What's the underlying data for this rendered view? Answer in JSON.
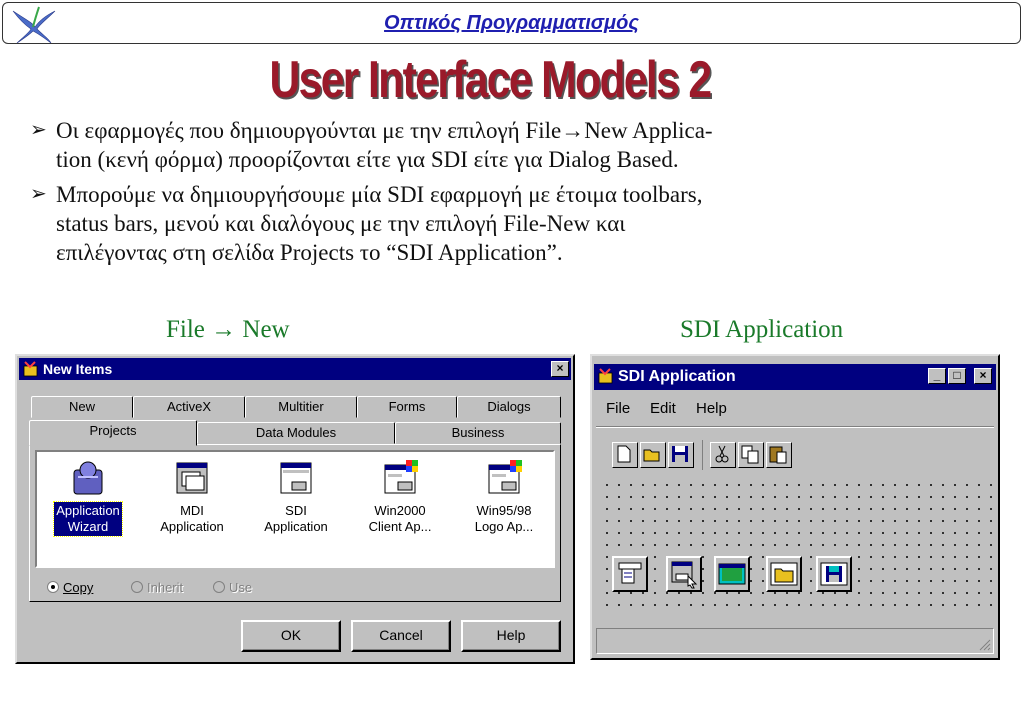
{
  "header": {
    "title": "Οπτικός Προγραμματισμός"
  },
  "slide": {
    "title": "User Interface Models 2",
    "bullets": [
      {
        "line1": "Οι εφαρμογές που δημιουργούνται με την επιλογή File→New Applica-",
        "line2": "tion (κενή φόρμα) προορίζονται είτε για SDI είτε για Dialog Based."
      },
      {
        "line1": "Μπορούμε να δημιουργήσουμε μία SDI εφαρμογή με έτοιμα toolbars,",
        "line2": "status bars, μενού και διαλόγους με την επιλογή File-New και",
        "line3": "επιλέγοντας στη σελίδα Projects το “SDI Application”."
      }
    ],
    "caption_left": "File → New",
    "caption_right": "SDI Application"
  },
  "new_items": {
    "title": "New Items",
    "tabs_back": [
      "New",
      "ActiveX",
      "Multitier",
      "Forms",
      "Dialogs"
    ],
    "tabs_front": [
      "Projects",
      "Data Modules",
      "Business"
    ],
    "items": [
      {
        "line1": "Application",
        "line2": "Wizard",
        "icon": "wizard-icon"
      },
      {
        "line1": "MDI",
        "line2": "Application",
        "icon": "mdi-app-icon"
      },
      {
        "line1": "SDI",
        "line2": "Application",
        "icon": "sdi-app-icon"
      },
      {
        "line1": "Win2000",
        "line2": "Client Ap...",
        "icon": "win2000-app-icon"
      },
      {
        "line1": "Win95/98",
        "line2": "Logo Ap...",
        "icon": "win95-app-icon"
      }
    ],
    "radios": [
      "Copy",
      "Inherit",
      "Use"
    ],
    "buttons": {
      "ok": "OK",
      "cancel": "Cancel",
      "help": "Help"
    }
  },
  "sdi_app": {
    "title": "SDI Application",
    "menu": [
      "File",
      "Edit",
      "Help"
    ],
    "controls": {
      "minimize": "_",
      "maximize": "□",
      "close": "×"
    }
  },
  "colors": {
    "title_bar": "#000080",
    "header_text": "#1f1fb0",
    "slide_title": "#9a1a2a",
    "caption": "#1a7a2a"
  }
}
